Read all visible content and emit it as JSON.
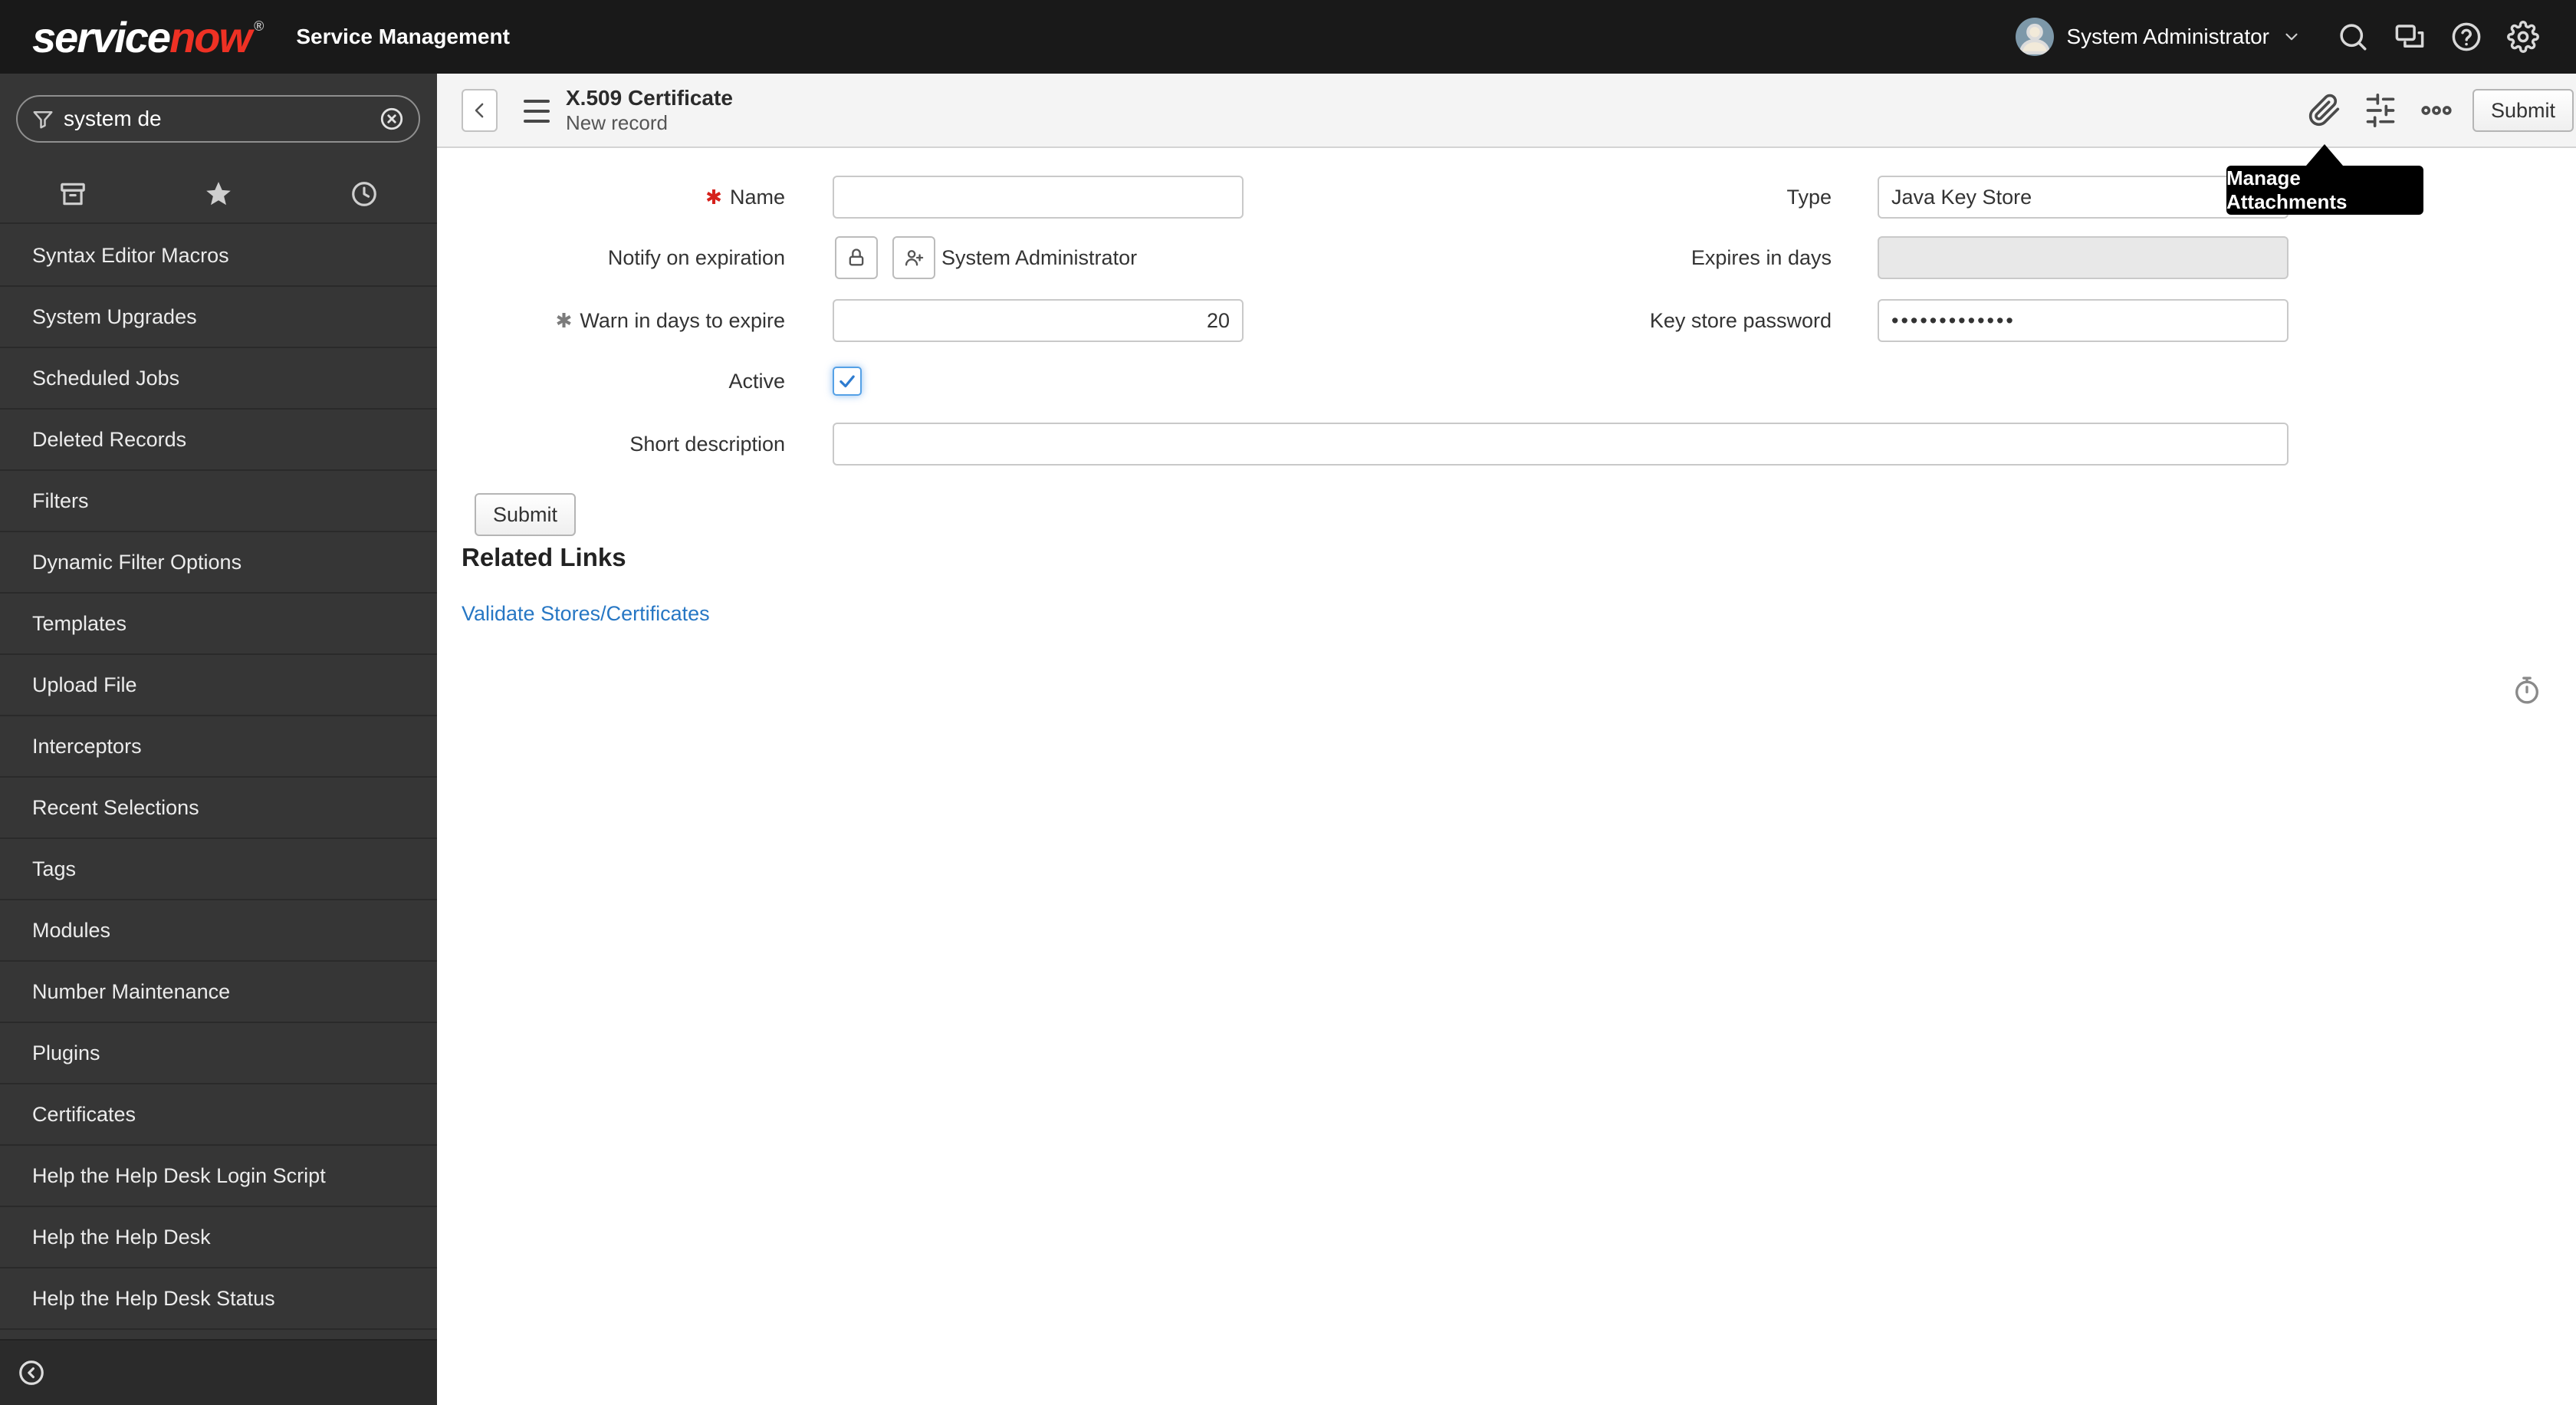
{
  "app": {
    "logo_service": "service",
    "logo_now": "now",
    "logo_tm": "®",
    "product": "Service Management"
  },
  "topnav": {
    "user": "System Administrator"
  },
  "sidebar": {
    "search_value": "system de",
    "items": [
      "Syntax Editor Macros",
      "System Upgrades",
      "Scheduled Jobs",
      "Deleted Records",
      "Filters",
      "Dynamic Filter Options",
      "Templates",
      "Upload File",
      "Interceptors",
      "Recent Selections",
      "Tags",
      "Modules",
      "Number Maintenance",
      "Plugins",
      "Certificates",
      "Help the Help Desk Login Script",
      "Help the Help Desk",
      "Help the Help Desk Status"
    ]
  },
  "record_header": {
    "title": "X.509 Certificate",
    "subtitle": "New record",
    "submit_label": "Submit"
  },
  "tooltip": {
    "text": "Manage Attachments"
  },
  "form": {
    "required_marker": "✱",
    "fields": {
      "name": {
        "label": "Name",
        "value": ""
      },
      "type": {
        "label": "Type",
        "value": "Java Key Store"
      },
      "notify_on_expiration": {
        "label": "Notify on expiration",
        "value": "System Administrator"
      },
      "expires_in_days": {
        "label": "Expires in days",
        "value": ""
      },
      "warn_in_days": {
        "label": "Warn in days to expire",
        "value": "20"
      },
      "key_store_password": {
        "label": "Key store password",
        "value": "•••••••••••••"
      },
      "active": {
        "label": "Active",
        "checked": true
      },
      "short_description": {
        "label": "Short description",
        "value": ""
      }
    },
    "submit_label": "Submit"
  },
  "related_links": {
    "heading": "Related Links",
    "links": [
      "Validate Stores/Certificates"
    ]
  },
  "icons": {
    "topbar": [
      "avatar",
      "caret-down-icon",
      "search-icon",
      "connect-chat-icon",
      "help-icon",
      "gear-icon"
    ],
    "sidebar": [
      "filter-funnel-icon",
      "clear-circle-icon",
      "applications-tab-icon",
      "favorites-star-icon",
      "history-clock-icon",
      "collapse-circle-icon"
    ],
    "toolbar": [
      "back-chevron-icon",
      "context-menu-icon",
      "attachments-paperclip-icon",
      "personalize-sliders-icon",
      "more-options-icon"
    ],
    "form": [
      "lock-icon",
      "add-user-icon",
      "checkmark-icon",
      "response-time-stopwatch-icon"
    ]
  }
}
